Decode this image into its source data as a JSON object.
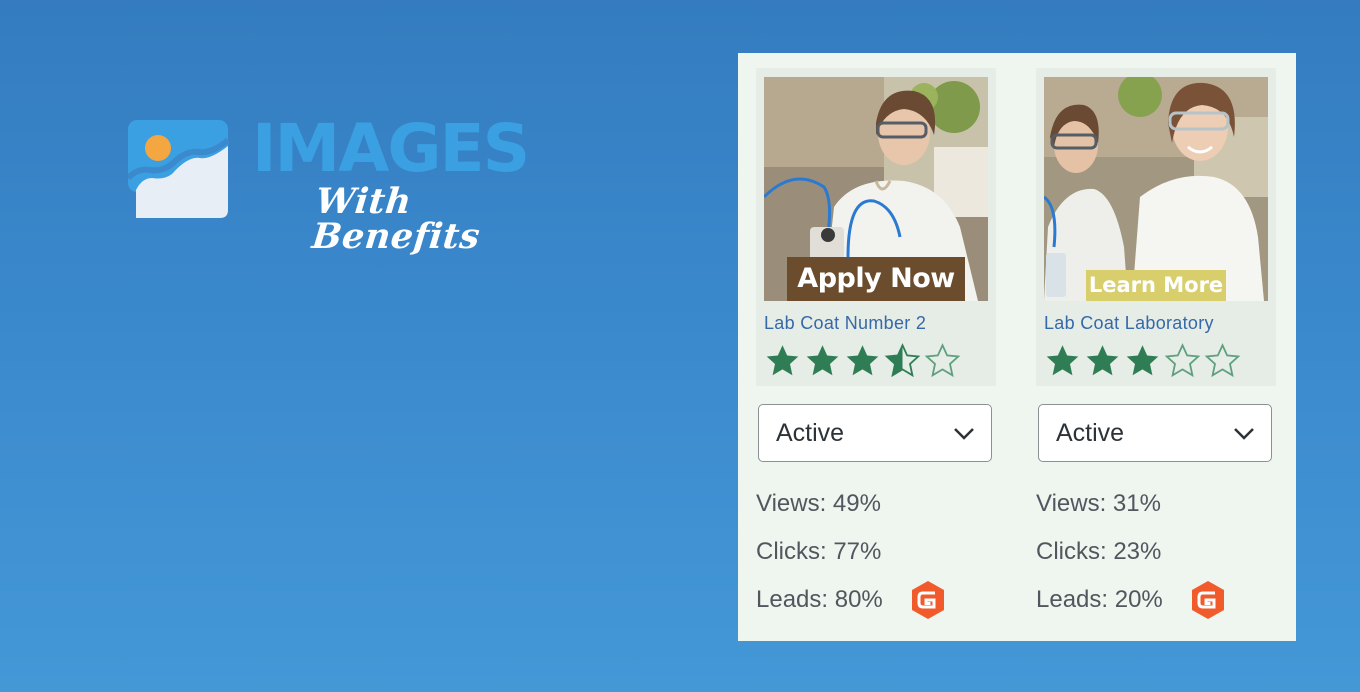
{
  "brand": {
    "logo_word": "IMAGES",
    "logo_tagline": "With Benefits",
    "colors": {
      "primary": "#3aa0e2",
      "sun": "#f4a640",
      "mountain": "#e8eef5"
    }
  },
  "cards": [
    {
      "cta_label": "Apply Now",
      "title": "Lab Coat Number 2",
      "rating": 3.5,
      "rating_max": 5,
      "status": "Active",
      "views": "Views: 49%",
      "clicks": "Clicks: 77%",
      "leads": "Leads: 80%",
      "lead_icon": "gravity-forms-icon"
    },
    {
      "cta_label": "Learn More",
      "title": "Lab Coat Laboratory",
      "rating": 3,
      "rating_max": 5,
      "status": "Active",
      "views": "Views: 31%",
      "clicks": "Clicks: 23%",
      "leads": "Leads: 20%",
      "lead_icon": "gravity-forms-icon"
    }
  ],
  "colors": {
    "panel_bg": "#eff6ef",
    "star_fill": "#2f7d55",
    "link": "#3569a8",
    "gravity_forms": "#f15a2b"
  }
}
